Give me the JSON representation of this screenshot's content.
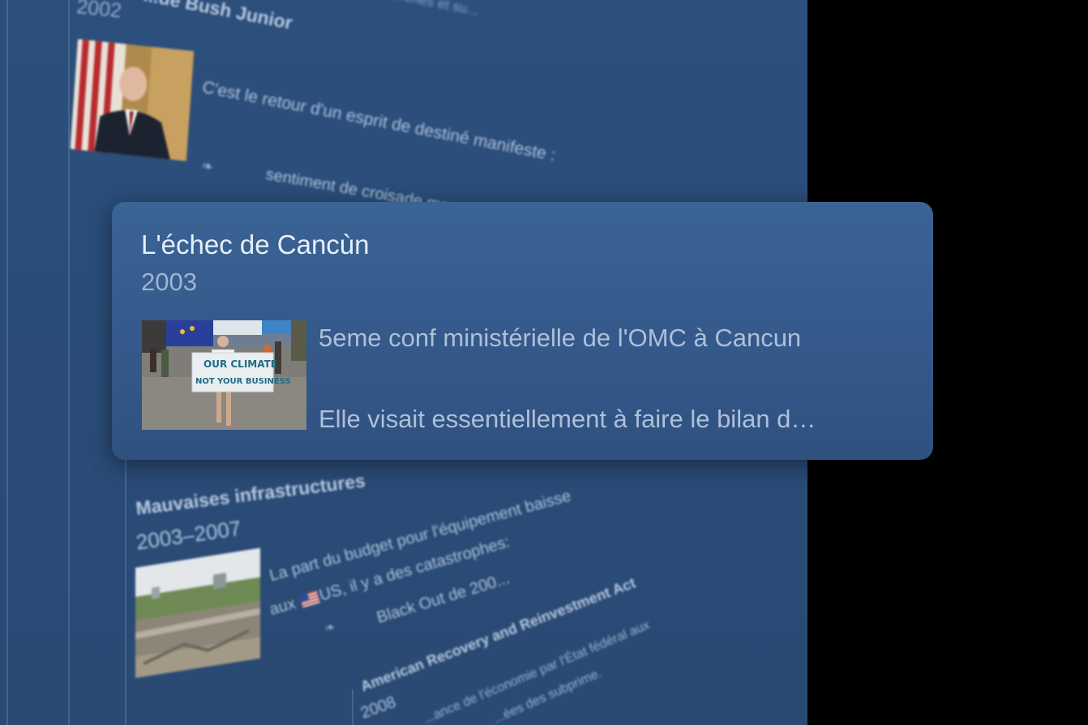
{
  "background": {
    "top_cut_text": "...ches et su...",
    "bush_event": {
      "title": "...de Bush Junior",
      "year": "2002",
      "description_1": "C'est le retour d'un esprit de destiné manifeste :",
      "bullet": "❧",
      "description_2": "sentiment de croisade mora..."
    },
    "infrastructure_event": {
      "title": "Mauvaises infrastructures",
      "year": "2003–2007",
      "description_1": "La part du budget pour l'équipement baisse",
      "description_2_prefix": "aux",
      "description_2_suffix": "US, il y a des catastrophes:",
      "bullet": "❧",
      "description_3": "Black Out de 200..."
    },
    "arra_event": {
      "title": "American Recovery and Reinvestment Act",
      "year": "2008",
      "description_1": "...ance de l'économie par l'État fédéral aux",
      "description_2": "...ées des subprime."
    }
  },
  "focused_card": {
    "title": "L'échec de Cancùn",
    "year": "2003",
    "description_1": "5eme conf ministérielle de l'OMC à Cancun",
    "description_2": "Elle visait essentiellement à faire le bilan d…",
    "thumbnail_sign_line1": "OUR CLIMATE",
    "thumbnail_sign_line2": "NOT YOUR BUSINESS"
  },
  "colors": {
    "panel_bg": "#2c4f7c",
    "card_bg": "#3a6495",
    "card_title": "#e6eef8",
    "card_muted": "#aec0d8"
  }
}
